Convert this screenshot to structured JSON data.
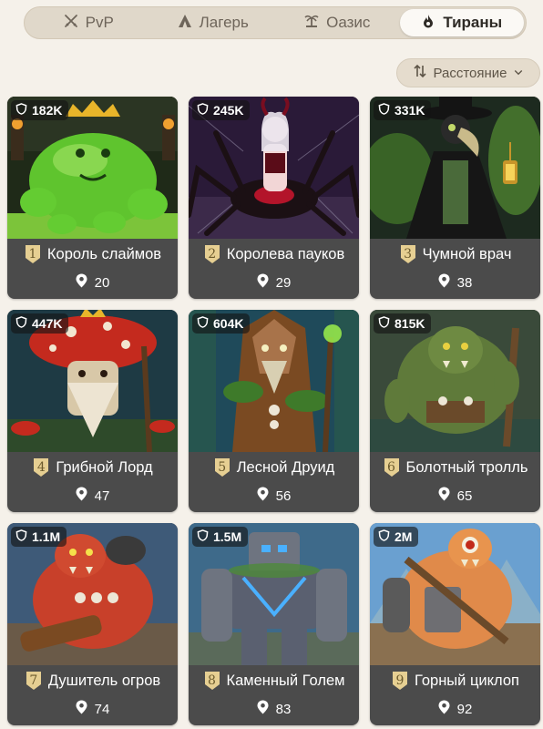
{
  "tabs": [
    {
      "label": "PvP",
      "icon": "crossed-swords-icon",
      "active": false
    },
    {
      "label": "Лагерь",
      "icon": "camp-tent-icon",
      "active": false
    },
    {
      "label": "Оазис",
      "icon": "palm-tree-icon",
      "active": false
    },
    {
      "label": "Тираны",
      "icon": "fire-drop-icon",
      "active": true
    }
  ],
  "sort": {
    "label": "Расстояние",
    "icon": "sort-arrows-icon"
  },
  "colors": {
    "background": "#f5f1ea",
    "card": "#4b4b4b",
    "tab_bar": "#e0d8ca",
    "rank_badge": "#e6cf92"
  },
  "tyrants": [
    {
      "rank": "1",
      "power": "182K",
      "name": "Король слаймов",
      "distance": "20"
    },
    {
      "rank": "2",
      "power": "245K",
      "name": "Королева пауков",
      "distance": "29"
    },
    {
      "rank": "3",
      "power": "331K",
      "name": "Чумной врач",
      "distance": "38"
    },
    {
      "rank": "4",
      "power": "447K",
      "name": "Грибной Лорд",
      "distance": "47"
    },
    {
      "rank": "5",
      "power": "604K",
      "name": "Лесной Друид",
      "distance": "56"
    },
    {
      "rank": "6",
      "power": "815K",
      "name": "Болотный тролль",
      "distance": "65"
    },
    {
      "rank": "7",
      "power": "1.1M",
      "name": "Душитель огров",
      "distance": "74"
    },
    {
      "rank": "8",
      "power": "1.5M",
      "name": "Каменный Голем",
      "distance": "83"
    },
    {
      "rank": "9",
      "power": "2M",
      "name": "Горный циклоп",
      "distance": "92"
    }
  ]
}
